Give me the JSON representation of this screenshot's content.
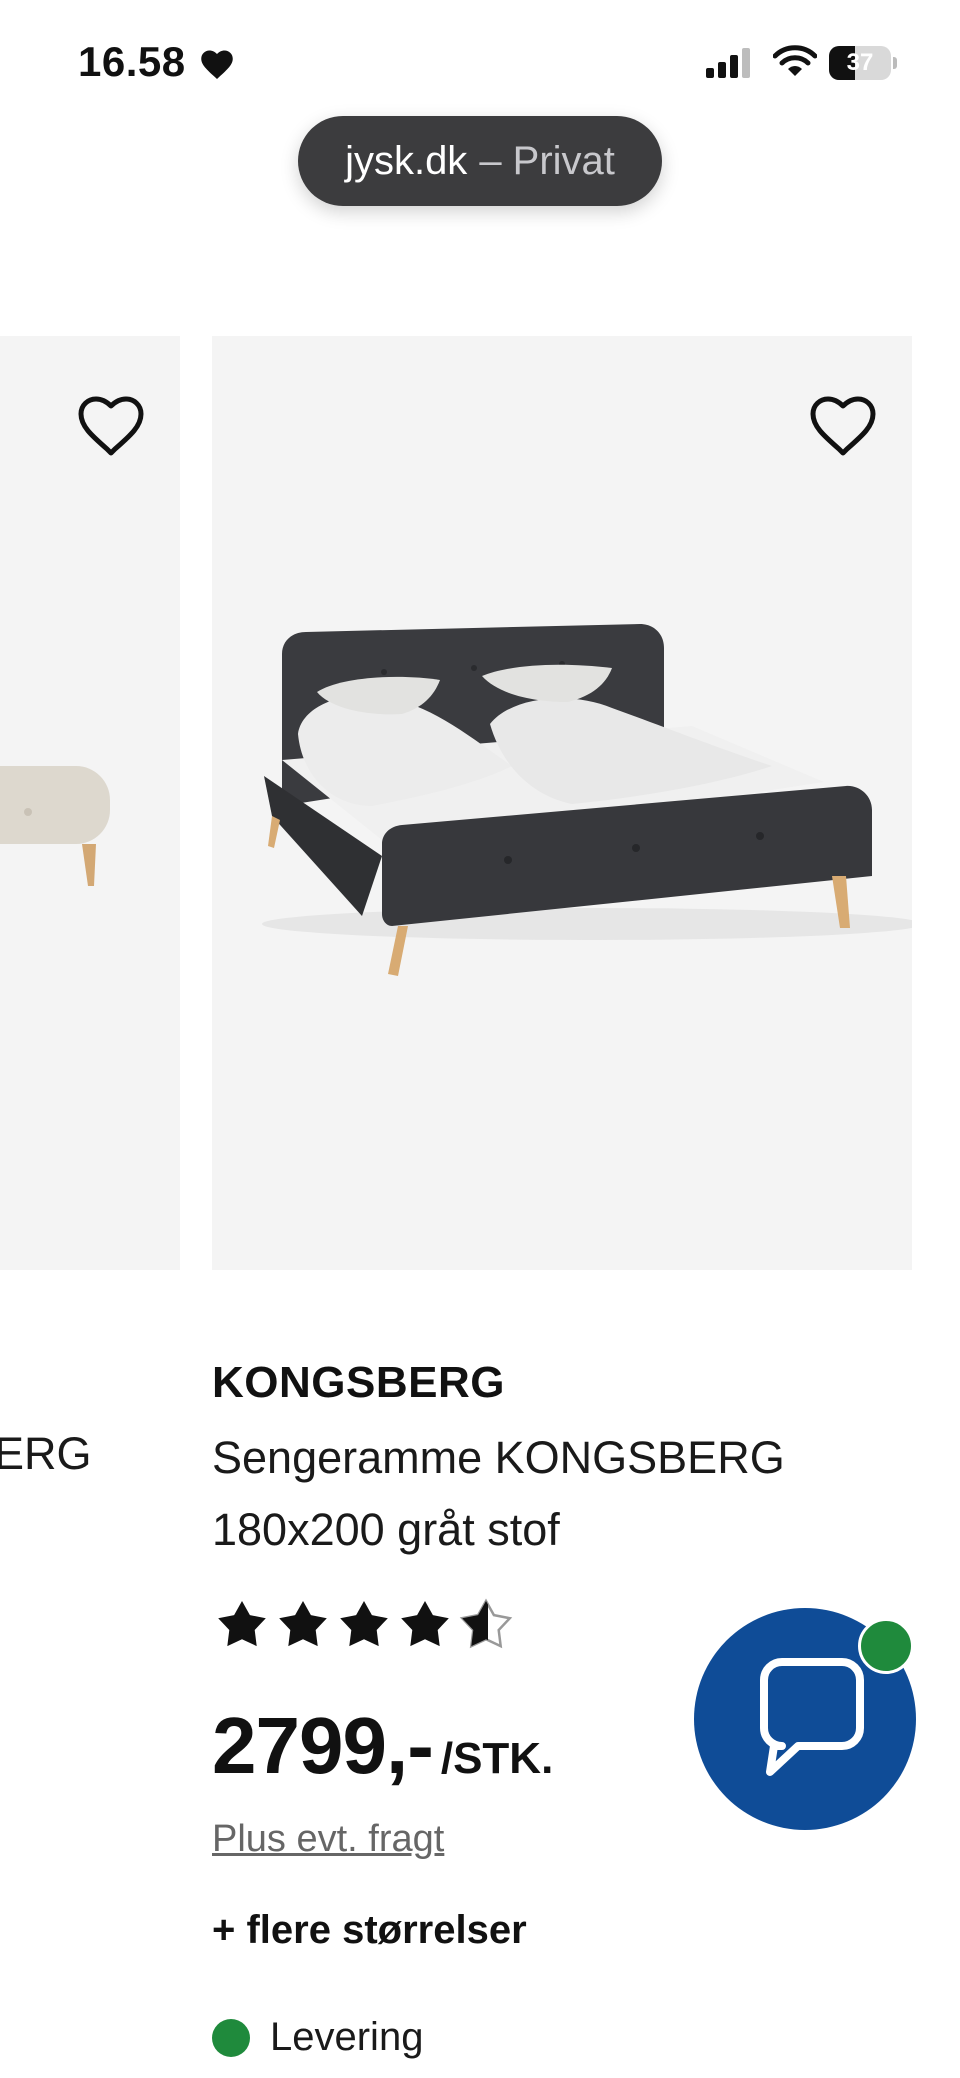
{
  "status_bar": {
    "time": "16.58",
    "battery": "37"
  },
  "browser": {
    "url_host": "jysk.dk",
    "url_suffix": "– Privat"
  },
  "left_card": {
    "name_fragment": "ERG"
  },
  "product": {
    "brand": "KONGSBERG",
    "title": "Sengeramme KONGSBERG 180x200 gråt stof",
    "rating": 4.5,
    "rating_max": 5,
    "price": "2799,-",
    "unit": "/STK.",
    "freight_link": "Plus evt. fragt",
    "more_sizes": "+ flere størrelser",
    "delivery_label": "Levering",
    "delivery_status_color": "#1f8a3c"
  },
  "chat": {
    "accent": "#0f4c97",
    "badge_color": "#1f8a3c"
  },
  "icons": {
    "favorite": "heart-outline-icon",
    "chat": "speech-bubble-icon",
    "rating": "star-icon"
  }
}
